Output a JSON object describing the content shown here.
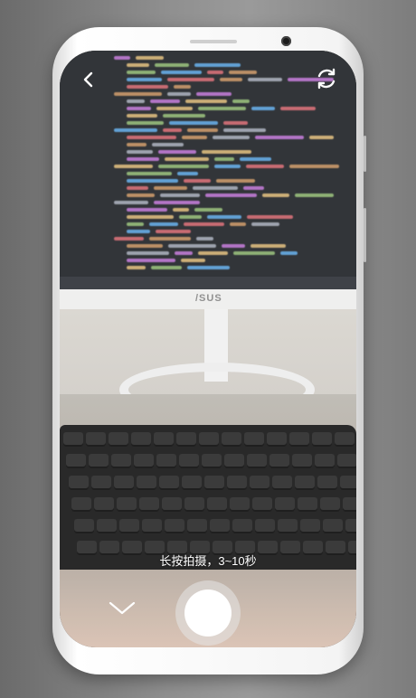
{
  "camera": {
    "hint_text": "长按拍摄，3~10秒",
    "monitor_brand": "/SUS"
  },
  "icons": {
    "back": "chevron-left-icon",
    "switch_camera": "camera-switch-icon",
    "collapse": "chevron-down-icon"
  },
  "colors": {
    "shutter_ring": "#e6e6e6",
    "shutter_center": "#ffffff",
    "overlay_text": "#ffffff"
  }
}
